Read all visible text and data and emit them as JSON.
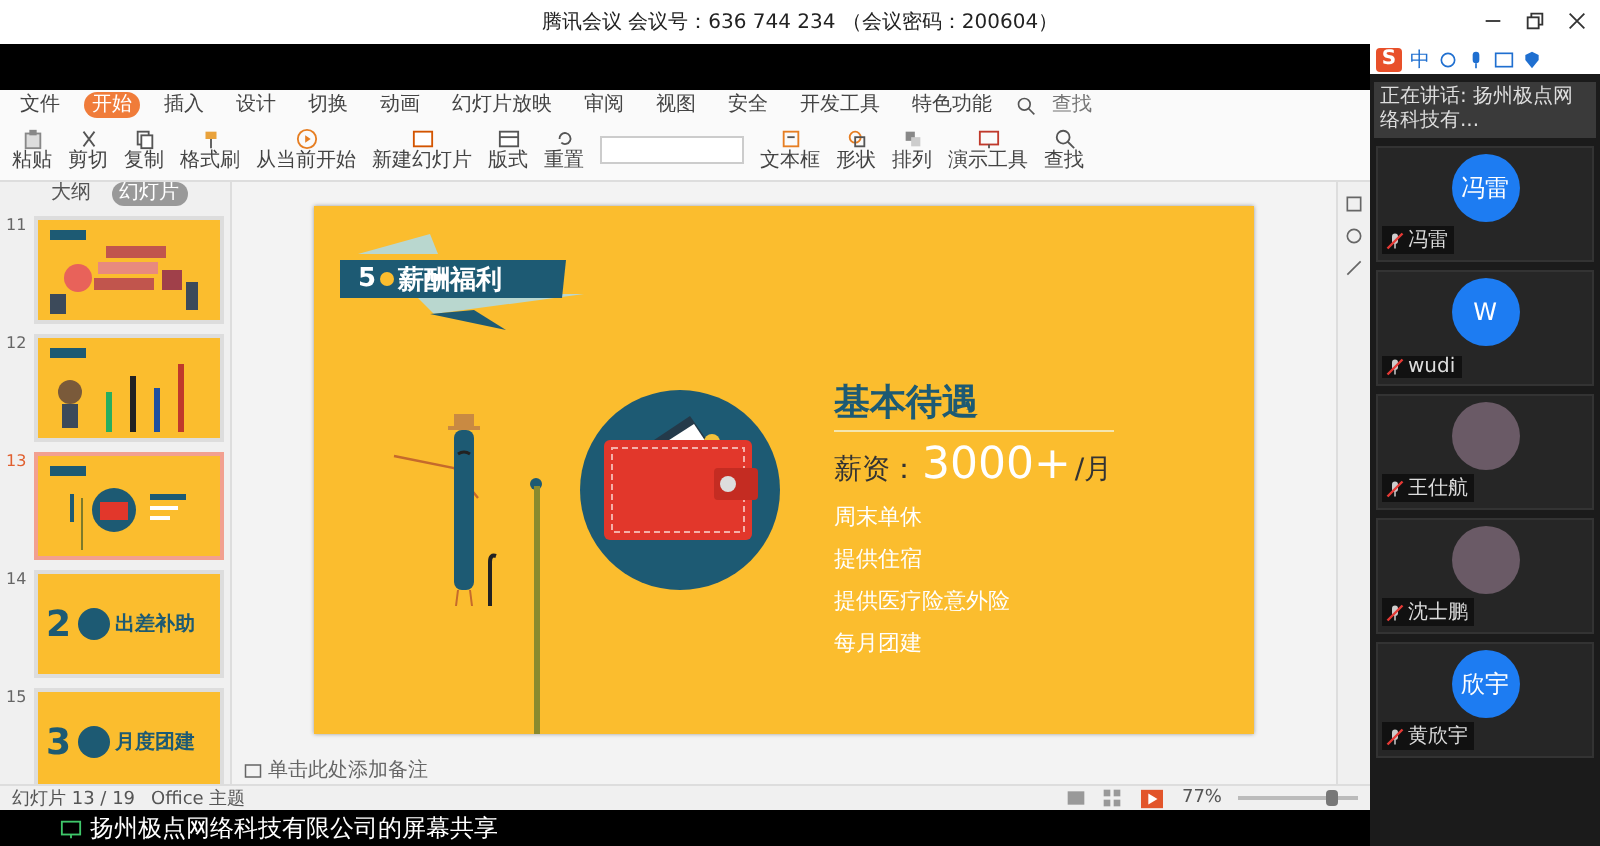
{
  "meeting": {
    "title": "腾讯会议 会议号：636 744 234 （会议密码：200604）"
  },
  "ime_toolbar": {
    "logo": "S",
    "mode": "中"
  },
  "presentation": {
    "menu_tabs": [
      {
        "label": "文件",
        "selected": false
      },
      {
        "label": "开始",
        "selected": true
      },
      {
        "label": "插入",
        "selected": false
      },
      {
        "label": "设计",
        "selected": false
      },
      {
        "label": "切换",
        "selected": false
      },
      {
        "label": "动画",
        "selected": false
      },
      {
        "label": "幻灯片放映",
        "selected": false
      },
      {
        "label": "审阅",
        "selected": false
      },
      {
        "label": "视图",
        "selected": false
      },
      {
        "label": "安全",
        "selected": false
      },
      {
        "label": "开发工具",
        "selected": false
      },
      {
        "label": "特色功能",
        "selected": false
      }
    ],
    "search": {
      "placeholder": "查找"
    },
    "ribbon": [
      "粘贴",
      "剪切",
      "复制",
      "格式刷",
      "从当前开始",
      "新建幻灯片",
      "版式",
      "重置",
      "文本框",
      "形状",
      "排列",
      "演示工具",
      "查找"
    ],
    "pane_tabs": [
      {
        "label": "大纲",
        "selected": false
      },
      {
        "label": "幻灯片",
        "selected": true
      }
    ],
    "thumbnails": [
      {
        "number": "11",
        "kind": "hands",
        "selected": false
      },
      {
        "number": "12",
        "kind": "pencils",
        "selected": false
      },
      {
        "number": "13",
        "kind": "wallet",
        "selected": true
      },
      {
        "number": "14",
        "kind": "numbered",
        "digit": "2",
        "caption": "出差补助",
        "selected": false
      },
      {
        "number": "15",
        "kind": "numbered",
        "digit": "3",
        "caption": "月度团建",
        "selected": false
      }
    ],
    "slide": {
      "banner_number": "5",
      "banner_title": "薪酬福利",
      "heading": "基本待遇",
      "salary_label": "薪资：",
      "salary_amount": "3000+",
      "salary_unit": "/月",
      "benefits": [
        "周末单休",
        "提供住宿",
        "提供医疗险意外险",
        "每月团建"
      ]
    },
    "notes": {
      "placeholder": "单击此处添加备注"
    },
    "status": {
      "slide_counter": "幻灯片 13 / 19",
      "theme": "Office 主题",
      "zoom": "77%"
    }
  },
  "participants": {
    "speaking": "正在讲话: 扬州极点网络科技有...",
    "tiles": [
      {
        "name": "冯雷",
        "kind": "initials",
        "avatar_text": "冯雷",
        "muted": true
      },
      {
        "name": "wudi",
        "kind": "initials",
        "avatar_text": "W",
        "muted": true
      },
      {
        "name": "王仕航",
        "kind": "photo",
        "muted": true
      },
      {
        "name": "沈士鹏",
        "kind": "photo",
        "muted": true
      },
      {
        "name": "黄欣宇",
        "kind": "initials",
        "avatar_text": "欣宇",
        "muted": true
      }
    ]
  },
  "share_bar": {
    "text": "扬州极点网络科技有限公司的屏幕共享"
  }
}
